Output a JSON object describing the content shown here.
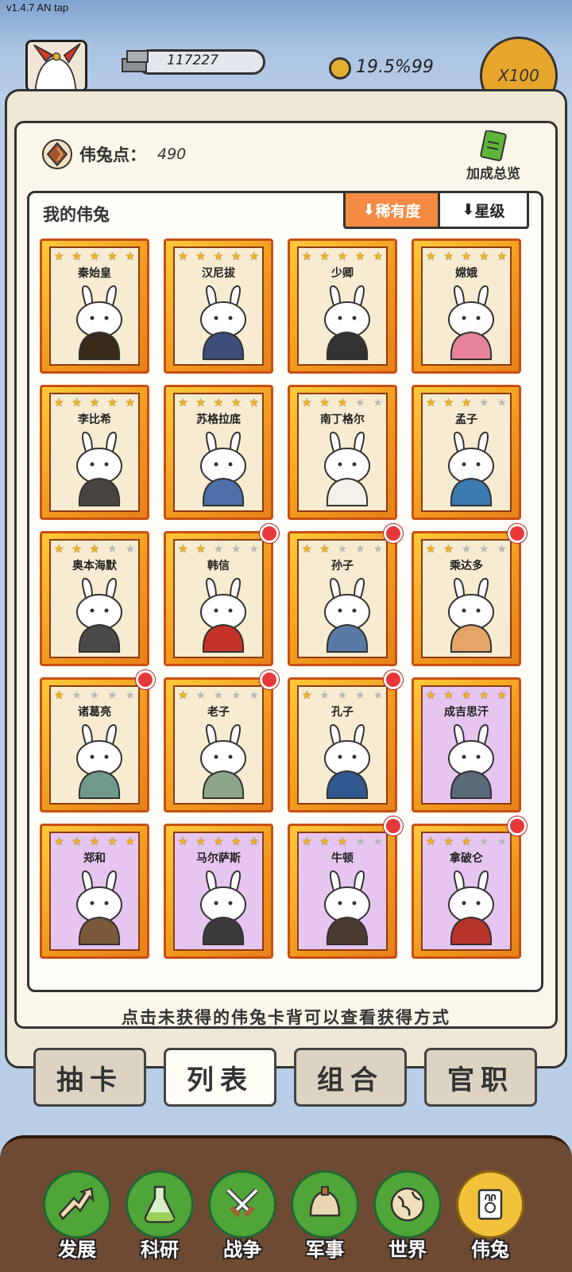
{
  "version": "v1.4.7 AN tap",
  "header": {
    "silver": "117227",
    "coin_rate": "19.5%99",
    "multiplier": "X100"
  },
  "points": {
    "label": "伟兔点：",
    "value": "490"
  },
  "bonus_overview": "加成总览",
  "list": {
    "title": "我的伟兔",
    "sort_rarity": "稀有度",
    "sort_star": "星级"
  },
  "cards": [
    {
      "name": "秦始皇",
      "stars": 5,
      "rarity": "gold",
      "new": false,
      "color": "#3a2a1a"
    },
    {
      "name": "汉尼拔",
      "stars": 5,
      "rarity": "gold",
      "new": false,
      "color": "#3c4f7a"
    },
    {
      "name": "少卿",
      "stars": 5,
      "rarity": "gold",
      "new": false,
      "color": "#333333"
    },
    {
      "name": "嫦娥",
      "stars": 5,
      "rarity": "gold",
      "new": false,
      "color": "#e7849a"
    },
    {
      "name": "李比希",
      "stars": 5,
      "rarity": "gold",
      "new": false,
      "color": "#4a4440"
    },
    {
      "name": "苏格拉底",
      "stars": 5,
      "rarity": "gold",
      "new": false,
      "color": "#4f6fa8"
    },
    {
      "name": "南丁格尔",
      "stars": 3,
      "rarity": "gold",
      "new": false,
      "color": "#f4f1ea"
    },
    {
      "name": "孟子",
      "stars": 3,
      "rarity": "gold",
      "new": false,
      "color": "#3c7bb0"
    },
    {
      "name": "奥本海默",
      "stars": 3,
      "rarity": "gold",
      "new": false,
      "color": "#4b4a48"
    },
    {
      "name": "韩信",
      "stars": 2,
      "rarity": "gold",
      "new": true,
      "color": "#c63228"
    },
    {
      "name": "孙子",
      "stars": 2,
      "rarity": "gold",
      "new": true,
      "color": "#5a7aa6"
    },
    {
      "name": "乘达多",
      "stars": 2,
      "rarity": "gold",
      "new": true,
      "color": "#e6a468"
    },
    {
      "name": "诸葛亮",
      "stars": 1,
      "rarity": "gold",
      "new": true,
      "color": "#6e9a8c"
    },
    {
      "name": "老子",
      "stars": 1,
      "rarity": "gold",
      "new": true,
      "color": "#8ea58a"
    },
    {
      "name": "孔子",
      "stars": 1,
      "rarity": "gold",
      "new": true,
      "color": "#325890"
    },
    {
      "name": "成吉思汗",
      "stars": 5,
      "rarity": "purple",
      "new": false,
      "color": "#5a6a78"
    },
    {
      "name": "郑和",
      "stars": 5,
      "rarity": "purple",
      "new": false,
      "color": "#7a5a3a"
    },
    {
      "name": "马尔萨斯",
      "stars": 5,
      "rarity": "purple",
      "new": false,
      "color": "#3a3a3a"
    },
    {
      "name": "牛顿",
      "stars": 3,
      "rarity": "purple",
      "new": true,
      "color": "#4a3a30"
    },
    {
      "name": "拿破仑",
      "stars": 3,
      "rarity": "purple",
      "new": true,
      "color": "#b8342a"
    }
  ],
  "hint": "点击未获得的伟兔卡背可以查看获得方式",
  "tabs": [
    "抽卡",
    "列表",
    "组合",
    "官职"
  ],
  "nav": [
    {
      "label": "发展",
      "icon": "arrow-up-icon"
    },
    {
      "label": "科研",
      "icon": "flask-icon"
    },
    {
      "label": "战争",
      "icon": "swords-icon"
    },
    {
      "label": "军事",
      "icon": "helmet-icon"
    },
    {
      "label": "世界",
      "icon": "globe-icon"
    },
    {
      "label": "伟兔",
      "icon": "rabbit-card-icon"
    }
  ]
}
